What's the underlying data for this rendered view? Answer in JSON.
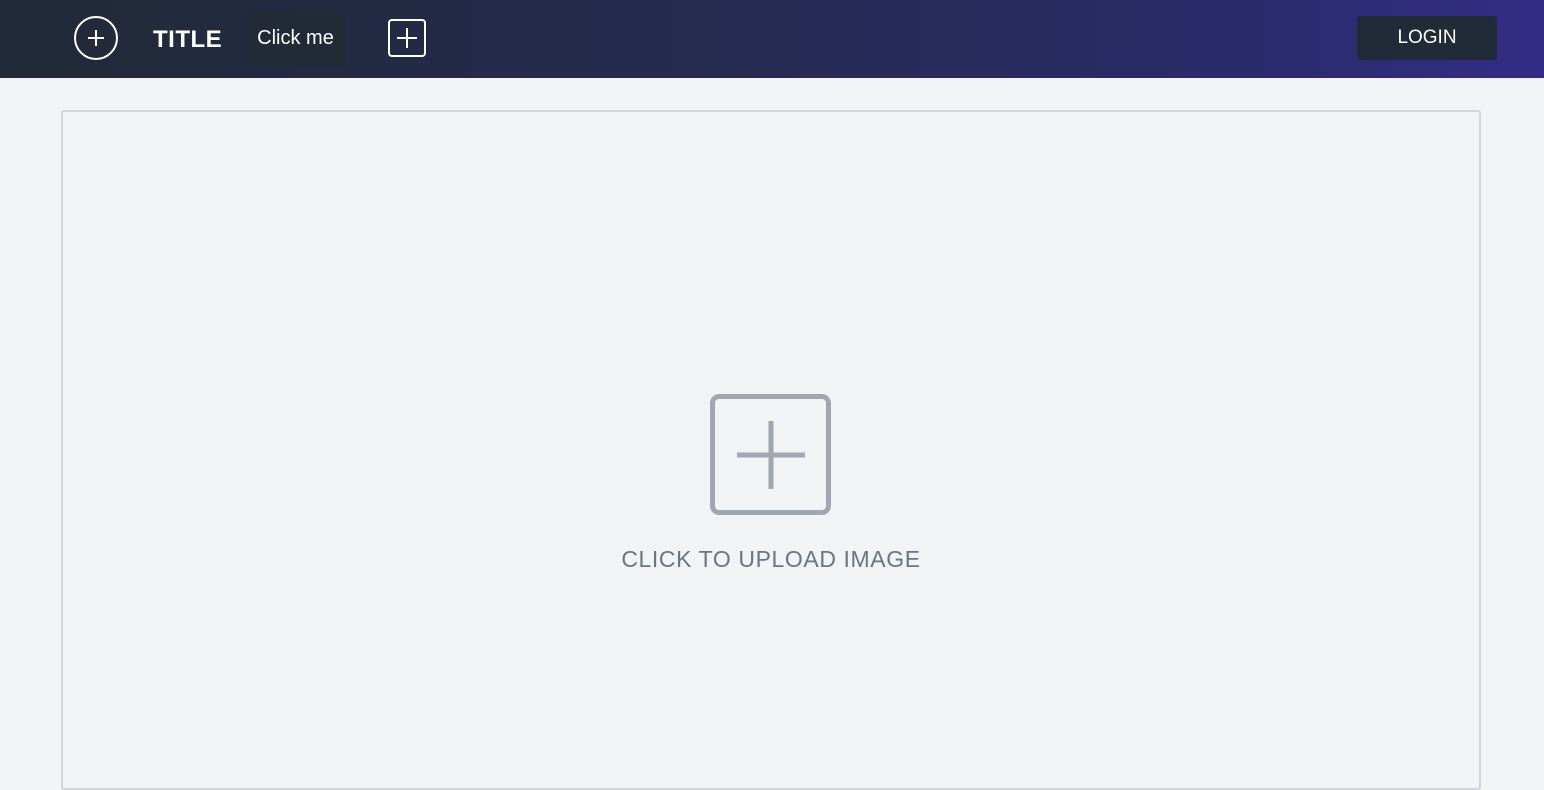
{
  "header": {
    "title": "TITLE",
    "click_me_label": "Click me",
    "login_label": "LOGIN",
    "icons": {
      "left_add": "circle-plus-icon",
      "add": "square-plus-icon"
    }
  },
  "upload": {
    "label": "CLICK TO UPLOAD IMAGE",
    "icon": "square-plus-icon"
  },
  "colors": {
    "header_gradient_start": "#212a37",
    "header_gradient_end": "#332c86",
    "page_background": "#f2f3f5",
    "upload_icon": "#a0a7b2",
    "upload_text": "#6c7480"
  }
}
